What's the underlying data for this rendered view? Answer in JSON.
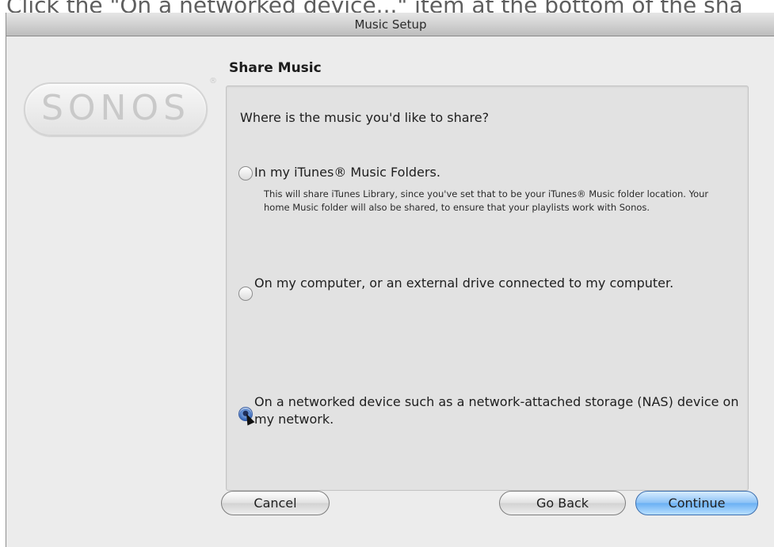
{
  "caption": "Click the \"On a networked device...\" item at the bottom of the sha",
  "window": {
    "title": "Music Setup"
  },
  "logo": {
    "text": "SONOS",
    "reg": "®"
  },
  "page": {
    "section_title": "Share Music",
    "question": "Where is the music you'd like to share?",
    "options": [
      {
        "label": "In my iTunes® Music Folders.",
        "description": "This will share iTunes Library, since you've set that to be your iTunes® Music folder location. Your home Music folder will also be shared, to ensure that your playlists work with Sonos.",
        "selected": false
      },
      {
        "label": "On my computer, or an external drive connected to my computer.",
        "description": "",
        "selected": false
      },
      {
        "label": "On a networked device such as a network-attached storage (NAS) device on my network.",
        "description": "",
        "selected": true
      }
    ]
  },
  "buttons": {
    "cancel": "Cancel",
    "go_back": "Go Back",
    "continue": "Continue"
  },
  "colors": {
    "window_bg": "#ececec",
    "panel_bg": "#e2e2e2",
    "primary_button": "#6bb1f4"
  }
}
